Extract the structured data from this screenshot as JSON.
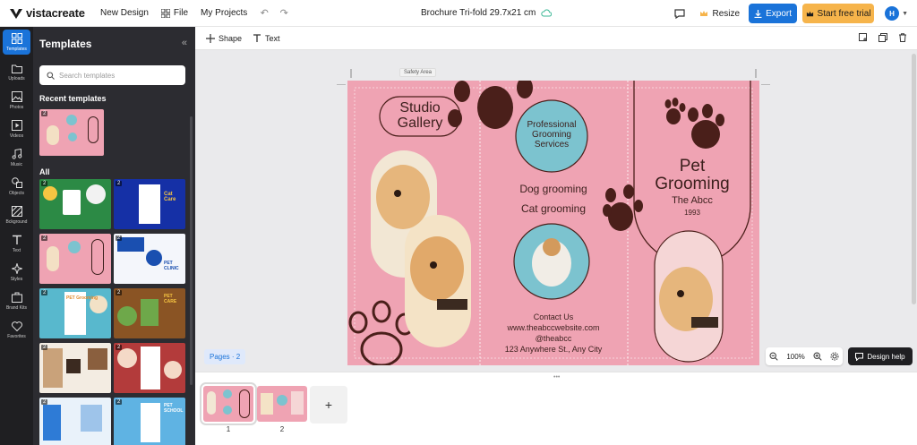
{
  "app": {
    "logo_text": "vistacreate",
    "new_design": "New Design",
    "file": "File",
    "my_projects": "My Projects",
    "document_title": "Brochure Tri-fold 29.7x21 cm",
    "resize": "Resize",
    "export": "Export",
    "trial": "Start free trial",
    "avatar_initial": "H"
  },
  "rail": [
    {
      "label": "Templates",
      "icon": "templates-icon"
    },
    {
      "label": "Uploads",
      "icon": "uploads-icon"
    },
    {
      "label": "Photos",
      "icon": "photos-icon"
    },
    {
      "label": "Videos",
      "icon": "videos-icon"
    },
    {
      "label": "Music",
      "icon": "music-icon"
    },
    {
      "label": "Objects",
      "icon": "objects-icon"
    },
    {
      "label": "Bckground",
      "icon": "background-icon"
    },
    {
      "label": "Text",
      "icon": "text-icon"
    },
    {
      "label": "Styles",
      "icon": "styles-icon"
    },
    {
      "label": "Brand Kits",
      "icon": "brand-kits-icon"
    },
    {
      "label": "Favorites",
      "icon": "favorites-icon"
    }
  ],
  "panel": {
    "title": "Templates",
    "search_placeholder": "Search templates",
    "recent_title": "Recent templates",
    "all_title": "All",
    "recent_badge": "2",
    "thumb_badges": [
      "2",
      "2",
      "2",
      "2",
      "2",
      "2",
      "2",
      "2",
      "2",
      "2"
    ],
    "thumb_texts": {
      "cat_care": "Cat Care",
      "pet_clinic": "PET CLINIC",
      "pet_grooming": "PET Grooming",
      "pet_care": "PET CARE",
      "pet_school": "PET SCHOOL"
    }
  },
  "toolbar": {
    "shape": "Shape",
    "text": "Text"
  },
  "canvas": {
    "safety_area": "Safety Area",
    "studio": "Studio",
    "gallery": "Gallery",
    "service_1": "Professional",
    "service_2": "Grooming",
    "service_3": "Services",
    "dog_grooming": "Dog grooming",
    "cat_grooming": "Cat grooming",
    "contact_us": "Contact Us",
    "website": "www.theabccwebsite.com",
    "handle": "@theabcc",
    "address": "123 Anywhere St., Any City",
    "pet": "Pet",
    "grooming": "Grooming",
    "brand": "The Abcc",
    "year": "1993"
  },
  "controls": {
    "pages": "Pages · 2",
    "zoom": "100%",
    "design_help": "Design help"
  },
  "pages": [
    {
      "num": "1"
    },
    {
      "num": "2"
    }
  ],
  "colors": {
    "accent": "#1a73d9",
    "trial": "#f6b44b",
    "brochure_pink": "#efa3b3",
    "brown": "#3b1f1c",
    "teal": "#7cc3cf"
  }
}
